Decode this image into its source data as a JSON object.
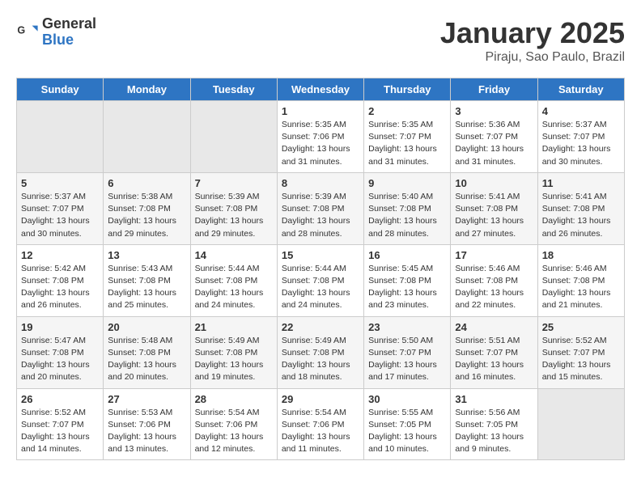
{
  "logo": {
    "line1": "General",
    "line2": "Blue"
  },
  "title": "January 2025",
  "subtitle": "Piraju, Sao Paulo, Brazil",
  "weekdays": [
    "Sunday",
    "Monday",
    "Tuesday",
    "Wednesday",
    "Thursday",
    "Friday",
    "Saturday"
  ],
  "weeks": [
    [
      {
        "day": "",
        "info": ""
      },
      {
        "day": "",
        "info": ""
      },
      {
        "day": "",
        "info": ""
      },
      {
        "day": "1",
        "info": "Sunrise: 5:35 AM\nSunset: 7:06 PM\nDaylight: 13 hours\nand 31 minutes."
      },
      {
        "day": "2",
        "info": "Sunrise: 5:35 AM\nSunset: 7:07 PM\nDaylight: 13 hours\nand 31 minutes."
      },
      {
        "day": "3",
        "info": "Sunrise: 5:36 AM\nSunset: 7:07 PM\nDaylight: 13 hours\nand 31 minutes."
      },
      {
        "day": "4",
        "info": "Sunrise: 5:37 AM\nSunset: 7:07 PM\nDaylight: 13 hours\nand 30 minutes."
      }
    ],
    [
      {
        "day": "5",
        "info": "Sunrise: 5:37 AM\nSunset: 7:07 PM\nDaylight: 13 hours\nand 30 minutes."
      },
      {
        "day": "6",
        "info": "Sunrise: 5:38 AM\nSunset: 7:08 PM\nDaylight: 13 hours\nand 29 minutes."
      },
      {
        "day": "7",
        "info": "Sunrise: 5:39 AM\nSunset: 7:08 PM\nDaylight: 13 hours\nand 29 minutes."
      },
      {
        "day": "8",
        "info": "Sunrise: 5:39 AM\nSunset: 7:08 PM\nDaylight: 13 hours\nand 28 minutes."
      },
      {
        "day": "9",
        "info": "Sunrise: 5:40 AM\nSunset: 7:08 PM\nDaylight: 13 hours\nand 28 minutes."
      },
      {
        "day": "10",
        "info": "Sunrise: 5:41 AM\nSunset: 7:08 PM\nDaylight: 13 hours\nand 27 minutes."
      },
      {
        "day": "11",
        "info": "Sunrise: 5:41 AM\nSunset: 7:08 PM\nDaylight: 13 hours\nand 26 minutes."
      }
    ],
    [
      {
        "day": "12",
        "info": "Sunrise: 5:42 AM\nSunset: 7:08 PM\nDaylight: 13 hours\nand 26 minutes."
      },
      {
        "day": "13",
        "info": "Sunrise: 5:43 AM\nSunset: 7:08 PM\nDaylight: 13 hours\nand 25 minutes."
      },
      {
        "day": "14",
        "info": "Sunrise: 5:44 AM\nSunset: 7:08 PM\nDaylight: 13 hours\nand 24 minutes."
      },
      {
        "day": "15",
        "info": "Sunrise: 5:44 AM\nSunset: 7:08 PM\nDaylight: 13 hours\nand 24 minutes."
      },
      {
        "day": "16",
        "info": "Sunrise: 5:45 AM\nSunset: 7:08 PM\nDaylight: 13 hours\nand 23 minutes."
      },
      {
        "day": "17",
        "info": "Sunrise: 5:46 AM\nSunset: 7:08 PM\nDaylight: 13 hours\nand 22 minutes."
      },
      {
        "day": "18",
        "info": "Sunrise: 5:46 AM\nSunset: 7:08 PM\nDaylight: 13 hours\nand 21 minutes."
      }
    ],
    [
      {
        "day": "19",
        "info": "Sunrise: 5:47 AM\nSunset: 7:08 PM\nDaylight: 13 hours\nand 20 minutes."
      },
      {
        "day": "20",
        "info": "Sunrise: 5:48 AM\nSunset: 7:08 PM\nDaylight: 13 hours\nand 20 minutes."
      },
      {
        "day": "21",
        "info": "Sunrise: 5:49 AM\nSunset: 7:08 PM\nDaylight: 13 hours\nand 19 minutes."
      },
      {
        "day": "22",
        "info": "Sunrise: 5:49 AM\nSunset: 7:08 PM\nDaylight: 13 hours\nand 18 minutes."
      },
      {
        "day": "23",
        "info": "Sunrise: 5:50 AM\nSunset: 7:07 PM\nDaylight: 13 hours\nand 17 minutes."
      },
      {
        "day": "24",
        "info": "Sunrise: 5:51 AM\nSunset: 7:07 PM\nDaylight: 13 hours\nand 16 minutes."
      },
      {
        "day": "25",
        "info": "Sunrise: 5:52 AM\nSunset: 7:07 PM\nDaylight: 13 hours\nand 15 minutes."
      }
    ],
    [
      {
        "day": "26",
        "info": "Sunrise: 5:52 AM\nSunset: 7:07 PM\nDaylight: 13 hours\nand 14 minutes."
      },
      {
        "day": "27",
        "info": "Sunrise: 5:53 AM\nSunset: 7:06 PM\nDaylight: 13 hours\nand 13 minutes."
      },
      {
        "day": "28",
        "info": "Sunrise: 5:54 AM\nSunset: 7:06 PM\nDaylight: 13 hours\nand 12 minutes."
      },
      {
        "day": "29",
        "info": "Sunrise: 5:54 AM\nSunset: 7:06 PM\nDaylight: 13 hours\nand 11 minutes."
      },
      {
        "day": "30",
        "info": "Sunrise: 5:55 AM\nSunset: 7:05 PM\nDaylight: 13 hours\nand 10 minutes."
      },
      {
        "day": "31",
        "info": "Sunrise: 5:56 AM\nSunset: 7:05 PM\nDaylight: 13 hours\nand 9 minutes."
      },
      {
        "day": "",
        "info": ""
      }
    ]
  ]
}
